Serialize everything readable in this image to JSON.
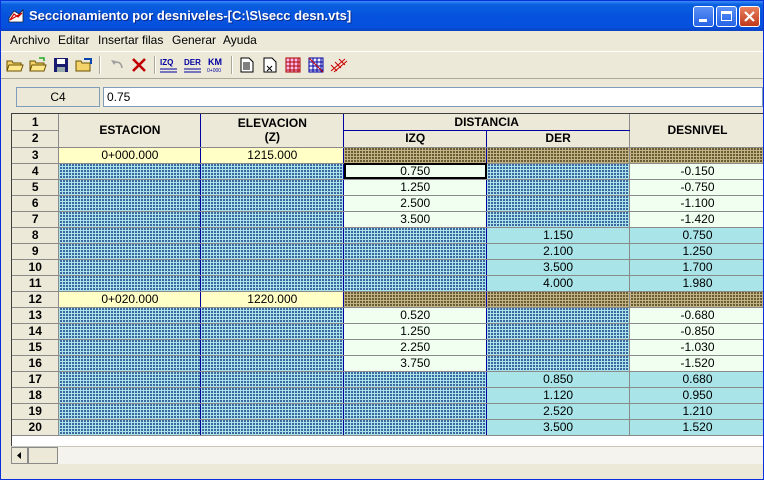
{
  "window": {
    "title": "Seccionamiento por desniveles-[C:\\S\\secc desn.vts]"
  },
  "menu": [
    {
      "label": "Archivo"
    },
    {
      "label": "Editar"
    },
    {
      "label": "Insertar filas"
    },
    {
      "label": "Generar"
    },
    {
      "label": "Ayuda"
    }
  ],
  "toolbar": [
    "open-folder-icon",
    "open-file-icon",
    "save-icon",
    "export-icon",
    "undo-icon",
    "delete-icon",
    "izq-icon",
    "der-icon",
    "km-icon",
    "document-icon",
    "text-file-icon",
    "grid-red-icon",
    "grid-blue-icon",
    "hatch-icon"
  ],
  "toolbar_text": {
    "izq": "IZQ",
    "der": "DER",
    "km": "KM",
    "km_sub": "0+000"
  },
  "formula": {
    "cell": "C4",
    "value": "0.75"
  },
  "grid": {
    "headers": {
      "estacion": "ESTACION",
      "elevacion": "ELEVACION",
      "elevacion_sub": "(Z)",
      "distancia": "DISTANCIA",
      "izq": "IZQ",
      "der": "DER",
      "desnivel": "DESNIVEL",
      "row1": "1",
      "row2": "2"
    },
    "rows": [
      {
        "n": "3",
        "estacion": "0+000.000",
        "elevacion": "1215.000",
        "izq": "",
        "der": "",
        "desnivel": "",
        "kind": "station"
      },
      {
        "n": "4",
        "estacion": "",
        "elevacion": "",
        "izq": "0.750",
        "der": "",
        "desnivel": "-0.150",
        "kind": "izq",
        "selected": true
      },
      {
        "n": "5",
        "estacion": "",
        "elevacion": "",
        "izq": "1.250",
        "der": "",
        "desnivel": "-0.750",
        "kind": "izq"
      },
      {
        "n": "6",
        "estacion": "",
        "elevacion": "",
        "izq": "2.500",
        "der": "",
        "desnivel": "-1.100",
        "kind": "izq"
      },
      {
        "n": "7",
        "estacion": "",
        "elevacion": "",
        "izq": "3.500",
        "der": "",
        "desnivel": "-1.420",
        "kind": "izq"
      },
      {
        "n": "8",
        "estacion": "",
        "elevacion": "",
        "izq": "",
        "der": "1.150",
        "desnivel": "0.750",
        "kind": "der"
      },
      {
        "n": "9",
        "estacion": "",
        "elevacion": "",
        "izq": "",
        "der": "2.100",
        "desnivel": "1.250",
        "kind": "der"
      },
      {
        "n": "10",
        "estacion": "",
        "elevacion": "",
        "izq": "",
        "der": "3.500",
        "desnivel": "1.700",
        "kind": "der"
      },
      {
        "n": "11",
        "estacion": "",
        "elevacion": "",
        "izq": "",
        "der": "4.000",
        "desnivel": "1.980",
        "kind": "der"
      },
      {
        "n": "12",
        "estacion": "0+020.000",
        "elevacion": "1220.000",
        "izq": "",
        "der": "",
        "desnivel": "",
        "kind": "station"
      },
      {
        "n": "13",
        "estacion": "",
        "elevacion": "",
        "izq": "0.520",
        "der": "",
        "desnivel": "-0.680",
        "kind": "izq"
      },
      {
        "n": "14",
        "estacion": "",
        "elevacion": "",
        "izq": "1.250",
        "der": "",
        "desnivel": "-0.850",
        "kind": "izq"
      },
      {
        "n": "15",
        "estacion": "",
        "elevacion": "",
        "izq": "2.250",
        "der": "",
        "desnivel": "-1.030",
        "kind": "izq"
      },
      {
        "n": "16",
        "estacion": "",
        "elevacion": "",
        "izq": "3.750",
        "der": "",
        "desnivel": "-1.520",
        "kind": "izq"
      },
      {
        "n": "17",
        "estacion": "",
        "elevacion": "",
        "izq": "",
        "der": "0.850",
        "desnivel": "0.680",
        "kind": "der"
      },
      {
        "n": "18",
        "estacion": "",
        "elevacion": "",
        "izq": "",
        "der": "1.120",
        "desnivel": "0.950",
        "kind": "der"
      },
      {
        "n": "19",
        "estacion": "",
        "elevacion": "",
        "izq": "",
        "der": "2.520",
        "desnivel": "1.210",
        "kind": "der"
      },
      {
        "n": "20",
        "estacion": "",
        "elevacion": "",
        "izq": "",
        "der": "3.500",
        "desnivel": "1.520",
        "kind": "der"
      }
    ]
  }
}
